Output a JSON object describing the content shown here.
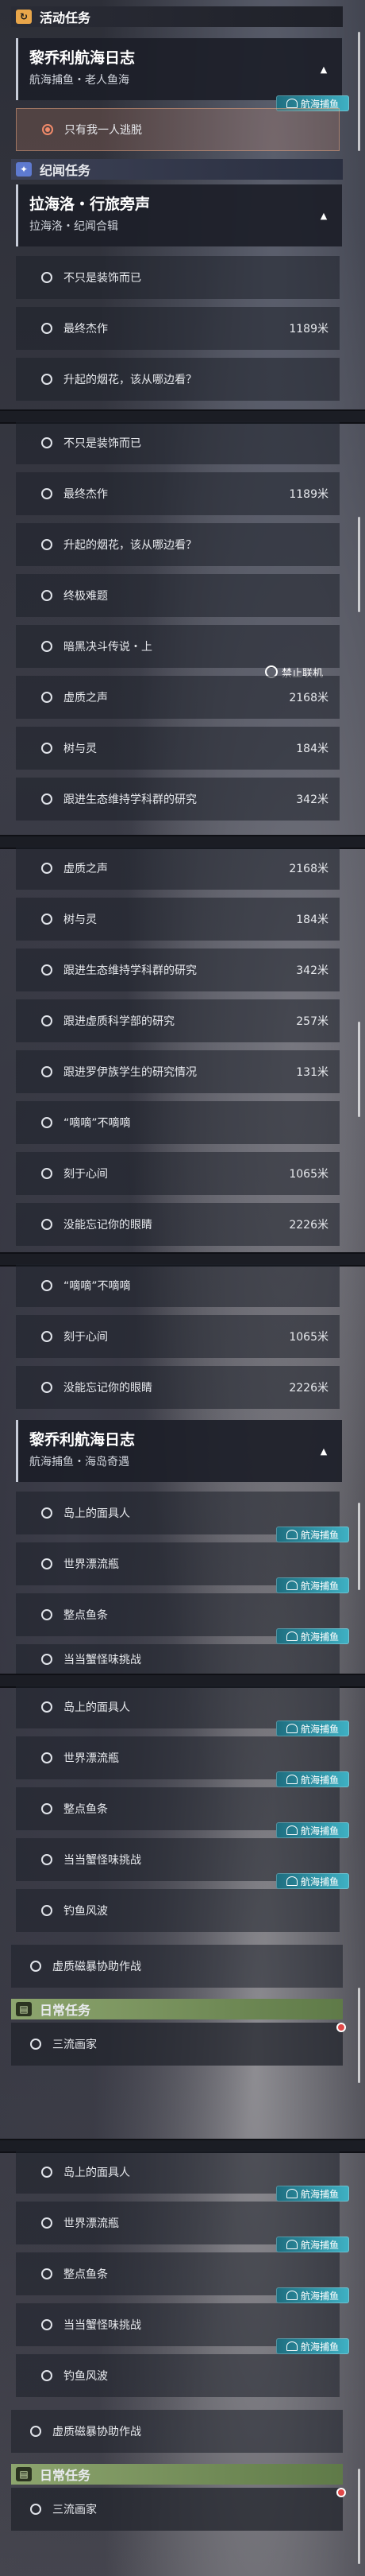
{
  "sections": {
    "active": "活动任务",
    "rumor": "纪闻任务",
    "daily": "日常任务"
  },
  "icons": {
    "active": "活动任务-icon",
    "rumor": "sparkle-icon",
    "daily": "book-icon"
  },
  "cards": {
    "lichuli_1": {
      "title": "黎乔利航海日志",
      "sub": "航海捕鱼・老人鱼海"
    },
    "lahailuo": {
      "title": "拉海洛・行旅旁声",
      "sub": "拉海洛・纪闻合辑"
    },
    "lichuli_2": {
      "title": "黎乔利航海日志",
      "sub": "航海捕鱼・海岛奇遇"
    }
  },
  "badge": "航海捕鱼",
  "offline": "禁止联机",
  "active_first": "只有我一人逃脱",
  "rumor_items": [
    {
      "label": "不只是装饰而已",
      "dist": ""
    },
    {
      "label": "最终杰作",
      "dist": "1189米"
    },
    {
      "label": "升起的烟花，该从哪边看？",
      "dist": ""
    },
    {
      "label": "终极难题",
      "dist": ""
    },
    {
      "label": "暗黑决斗传说・上",
      "dist": ""
    },
    {
      "label": "虚质之声",
      "dist": "2168米"
    },
    {
      "label": "树与灵",
      "dist": "184米"
    },
    {
      "label": "跟进生态维持学科群的研究",
      "dist": "342米"
    },
    {
      "label": "跟进虚质科学部的研究",
      "dist": "257米"
    },
    {
      "label": "跟进罗伊族学生的研究情况",
      "dist": "131米"
    },
    {
      "label": "“嘀嘀”不嘀嘀",
      "dist": ""
    },
    {
      "label": "刻于心间",
      "dist": "1065米"
    },
    {
      "label": "没能忘记你的眼睛",
      "dist": "2226米"
    }
  ],
  "voyage_items": [
    "岛上的面具人",
    "世界漂流瓶",
    "整点鱼条",
    "当当蟹怪味挑战",
    "钓鱼风波"
  ],
  "single_task": "虚质磁暴协助作战",
  "daily_task": "三流画家"
}
